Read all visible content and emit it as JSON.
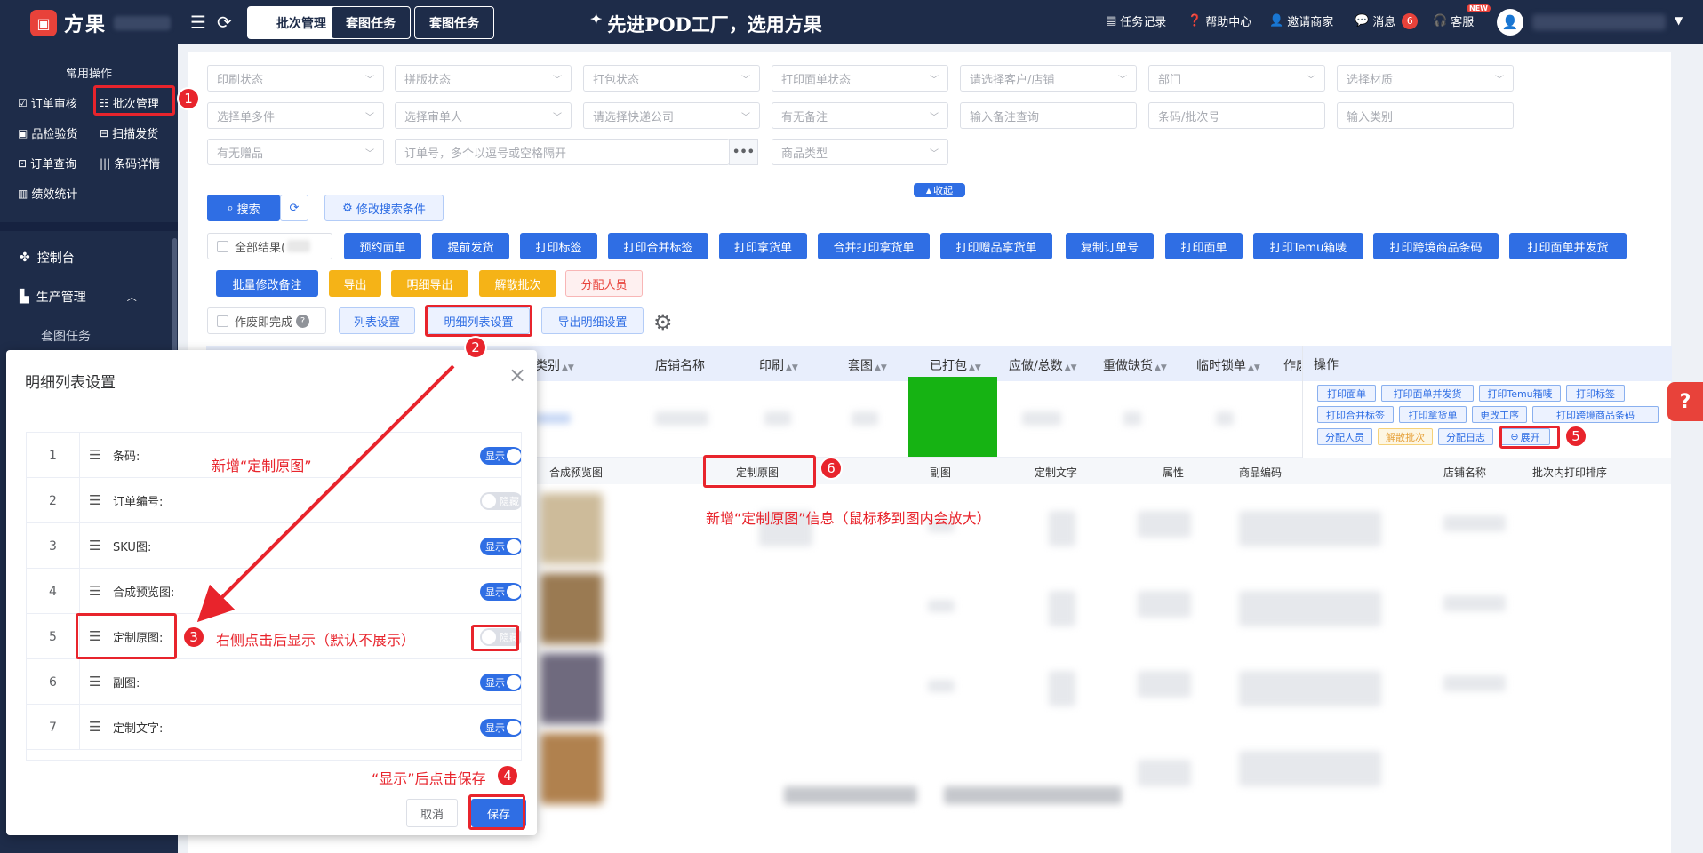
{
  "app": {
    "name": "方果"
  },
  "topbar": {
    "tabs": [
      "批次管理",
      "套图任务",
      "套图任务"
    ],
    "slogan": "先进POD工厂，选用方果",
    "links": {
      "task_log": "任务记录",
      "help": "帮助中心",
      "invite": "邀请商家",
      "messages": "消息",
      "message_count": "6",
      "service": "客服",
      "new_badge": "NEW"
    }
  },
  "sidebar": {
    "heading": "常用操作",
    "ops": [
      "订单审核",
      "批次管理",
      "品检验货",
      "扫描发货",
      "订单查询",
      "条码详情",
      "绩效统计"
    ],
    "nav": {
      "console": "控制台",
      "production": "生产管理",
      "sub_item": "套图任务"
    }
  },
  "filters": {
    "row1": [
      "印刷状态",
      "拼版状态",
      "打包状态",
      "打印面单状态",
      "请选择客户/店铺",
      "部门",
      "选择材质"
    ],
    "row2": [
      "选择单多件",
      "选择审单人",
      "请选择快递公司",
      "有无备注",
      "输入备注查询",
      "条码/批次号",
      "输入类别"
    ],
    "row3": {
      "gift": "有无赠品",
      "order_no": "订单号，多个以逗号或空格隔开",
      "product_type": "商品类型"
    },
    "collapse": "收起"
  },
  "toolbar": {
    "search": "搜索",
    "modify_search": "修改搜索条件",
    "all_results": "全部结果(",
    "actions": [
      "预约面单",
      "提前发货",
      "打印标签",
      "打印合并标签",
      "打印拿货单",
      "合并打印拿货单",
      "打印赠品拿货单",
      "复制订单号",
      "打印面单",
      "打印Temu箱唛",
      "打印跨境商品条码",
      "打印面单并发货"
    ],
    "batch_note": "批量修改备注",
    "export": "导出",
    "detail_export": "明细导出",
    "dissolve": "解散批次",
    "assign": "分配人员",
    "void_done": "作废即完成",
    "list_settings": "列表设置",
    "detail_list_settings": "明细列表设置",
    "export_detail_settings": "导出明细设置"
  },
  "table": {
    "headers": [
      "类别",
      "店铺名称",
      "印刷",
      "套图",
      "已打包",
      "应做/总数",
      "重做缺货",
      "临时锁单",
      "作废"
    ],
    "ops_header": "操作",
    "op_buttons": [
      "打印面单",
      "打印面单并发货",
      "打印Temu箱唛",
      "打印标签",
      "打印合并标签",
      "打印拿货单",
      "更改工序",
      "打印跨境商品条码",
      "分配人员",
      "解散批次",
      "分配日志",
      "展开"
    ]
  },
  "detail": {
    "headers": [
      "合成预览图",
      "定制原图",
      "副图",
      "定制文字",
      "属性",
      "商品编码",
      "店铺名称",
      "批次内打印排序"
    ]
  },
  "dialog": {
    "title": "明细列表设置",
    "rows": [
      {
        "idx": "1",
        "label": "条码:",
        "on": true,
        "state": "显示"
      },
      {
        "idx": "2",
        "label": "订单编号:",
        "on": false,
        "state": "隐藏"
      },
      {
        "idx": "3",
        "label": "SKU图:",
        "on": true,
        "state": "显示"
      },
      {
        "idx": "4",
        "label": "合成预览图:",
        "on": true,
        "state": "显示"
      },
      {
        "idx": "5",
        "label": "定制原图:",
        "on": false,
        "state": "隐藏"
      },
      {
        "idx": "6",
        "label": "副图:",
        "on": true,
        "state": "显示"
      },
      {
        "idx": "7",
        "label": "定制文字:",
        "on": true,
        "state": "显示"
      }
    ],
    "cancel": "取消",
    "save": "保存"
  },
  "annotations": {
    "badges": [
      "1",
      "2",
      "3",
      "4",
      "5",
      "6"
    ],
    "add_custom_image": "新增“定制原图”",
    "click_right": "右侧点击后显示（默认不展示）",
    "save_after": "“显示”后点击保存",
    "new_info": "新增“定制原图”信息（鼠标移到图内会放大）"
  },
  "colors": {
    "nav_bg": "#1e2c49",
    "primary": "#2f6ee4",
    "warning": "#f5b317",
    "annotation": "#e8242c",
    "packed": "#16b313"
  }
}
